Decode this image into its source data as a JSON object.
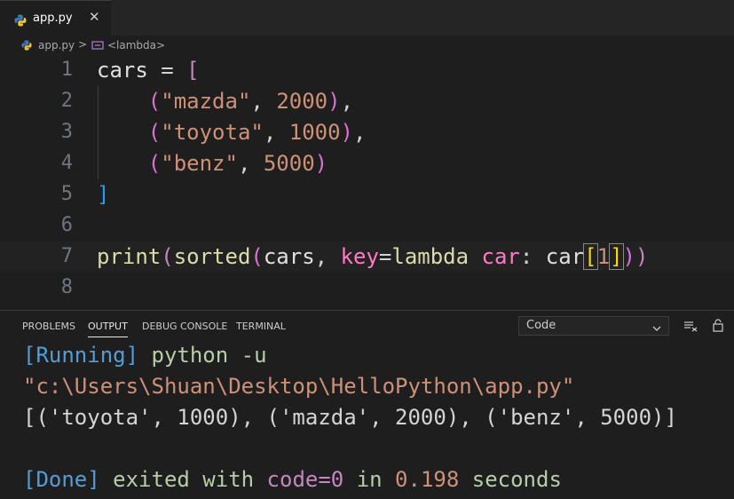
{
  "tab": {
    "filename": "app.py"
  },
  "breadcrumb": {
    "file": "app.py",
    "separator": ">",
    "symbol": "<lambda>"
  },
  "editor": {
    "line_numbers": [
      "1",
      "2",
      "3",
      "4",
      "5",
      "6",
      "7",
      "8"
    ],
    "lines": [
      [
        {
          "t": "cars",
          "c": "c-white"
        },
        {
          "t": " = ",
          "c": "c-op"
        },
        {
          "t": "[",
          "c": "c-b1"
        }
      ],
      [
        {
          "t": "    ",
          "c": "c-op"
        },
        {
          "t": "(",
          "c": "c-b2"
        },
        {
          "t": "\"mazda\"",
          "c": "c-str"
        },
        {
          "t": ", ",
          "c": "c-op"
        },
        {
          "t": "2000",
          "c": "c-str"
        },
        {
          "t": ")",
          "c": "c-b2"
        },
        {
          "t": ",",
          "c": "c-op"
        }
      ],
      [
        {
          "t": "    ",
          "c": "c-op"
        },
        {
          "t": "(",
          "c": "c-b2"
        },
        {
          "t": "\"toyota\"",
          "c": "c-str"
        },
        {
          "t": ", ",
          "c": "c-op"
        },
        {
          "t": "1000",
          "c": "c-str"
        },
        {
          "t": ")",
          "c": "c-b2"
        },
        {
          "t": ",",
          "c": "c-op"
        }
      ],
      [
        {
          "t": "    ",
          "c": "c-op"
        },
        {
          "t": "(",
          "c": "c-b2"
        },
        {
          "t": "\"benz\"",
          "c": "c-str"
        },
        {
          "t": ", ",
          "c": "c-op"
        },
        {
          "t": "5000",
          "c": "c-str"
        },
        {
          "t": ")",
          "c": "c-b2"
        }
      ],
      [
        {
          "t": "]",
          "c": "c-b3"
        }
      ],
      [],
      [
        {
          "t": "print",
          "c": "c-fn"
        },
        {
          "t": "(",
          "c": "c-b1"
        },
        {
          "t": "sorted",
          "c": "c-fn"
        },
        {
          "t": "(",
          "c": "c-b2"
        },
        {
          "t": "cars",
          "c": "c-white"
        },
        {
          "t": ", ",
          "c": "c-op"
        },
        {
          "t": "key",
          "c": "c-pink"
        },
        {
          "t": "=",
          "c": "c-op"
        },
        {
          "t": "lambda",
          "c": "c-fn"
        },
        {
          "t": " ",
          "c": "c-op"
        },
        {
          "t": "car",
          "c": "c-pink"
        },
        {
          "t": ": ",
          "c": "c-op"
        },
        {
          "t": "car",
          "c": "c-white"
        },
        {
          "t": "[",
          "c": "c-gold bm"
        },
        {
          "t": "1",
          "c": "c-str"
        },
        {
          "t": "]",
          "c": "c-gold bm"
        },
        {
          "t": ")",
          "c": "c-b2"
        },
        {
          "t": ")",
          "c": "c-b1"
        }
      ],
      []
    ],
    "active_line": 7
  },
  "panel": {
    "tabs": [
      "PROBLEMS",
      "OUTPUT",
      "DEBUG CONSOLE",
      "TERMINAL"
    ],
    "active_tab": "OUTPUT",
    "channel_select": "Code",
    "output_lines": [
      [
        {
          "t": "[Running]",
          "c": "o-blue"
        },
        {
          "t": " python -u",
          "c": "o-green"
        }
      ],
      [
        {
          "t": "\"c:\\Users\\Shuan\\Desktop\\HelloPython\\app.py\"",
          "c": "o-str"
        }
      ],
      [
        {
          "t": "[('toyota', 1000), ('mazda', 2000), ('benz', 5000)]",
          "c": "o-white"
        }
      ],
      [],
      [
        {
          "t": "[Done]",
          "c": "o-blue"
        },
        {
          "t": " exited with ",
          "c": "o-green"
        },
        {
          "t": "code=0",
          "c": "o-purple"
        },
        {
          "t": " in ",
          "c": "o-green"
        },
        {
          "t": "0.198",
          "c": "o-num"
        },
        {
          "t": " seconds",
          "c": "o-green"
        }
      ]
    ]
  },
  "icons": {
    "tab_file": "python-icon",
    "tab_close": "close-icon",
    "breadcrumb_file": "python-icon",
    "breadcrumb_symbol": "lambda-symbol-icon",
    "select_arrow": "chevron-down-icon",
    "clear": "clear-output-icon",
    "lock": "lock-scroll-icon"
  }
}
